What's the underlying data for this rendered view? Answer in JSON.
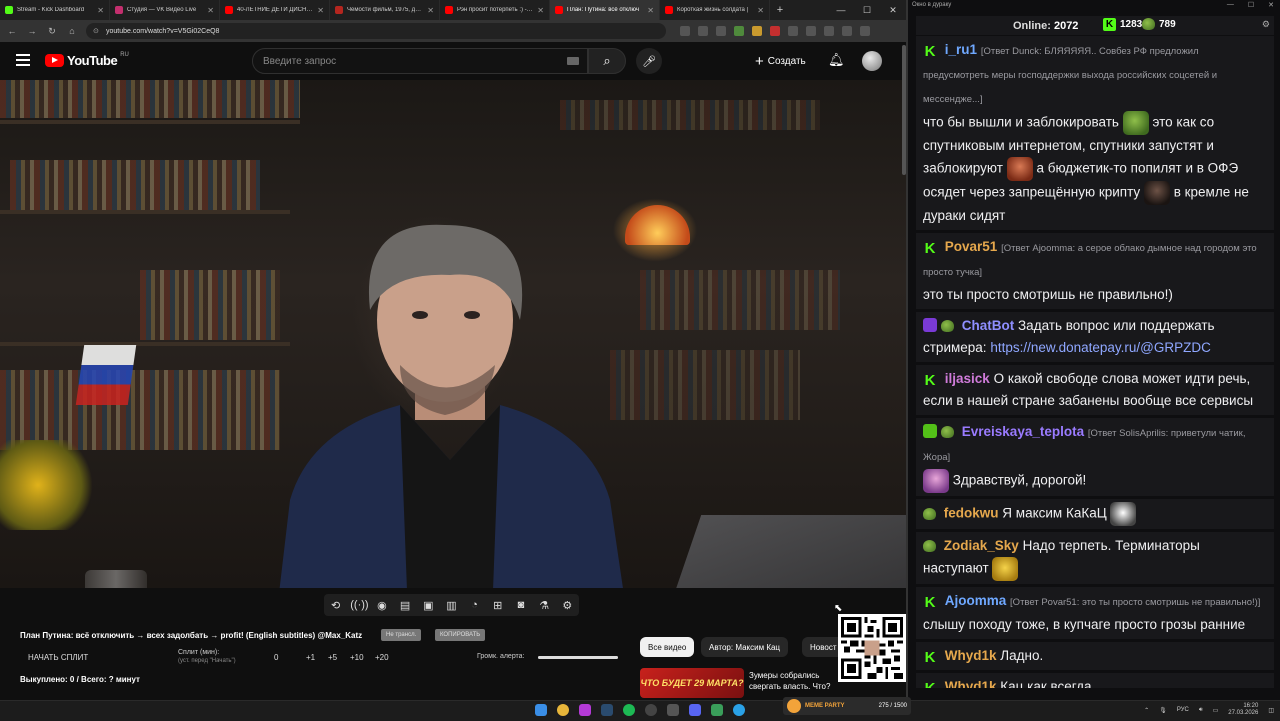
{
  "browser": {
    "tabs": [
      {
        "label": "Stream - Kick Dashboard",
        "color": "#53fc18",
        "active": false
      },
      {
        "label": "Студия — VK Видео Live",
        "color": "#c42f6e",
        "active": false
      },
      {
        "label": "40-ЛЕТНИЕ ДЕТИ ДИСНЕЯ",
        "color": "#ff0000",
        "active": false
      },
      {
        "label": "Чемости фильм, 1975, дата",
        "color": "#b5261f",
        "active": false
      },
      {
        "label": "Рэн просит потерпеть :) - Yo",
        "color": "#ff0000",
        "active": false
      },
      {
        "label": "План: Путина: всё отключ",
        "color": "#ff0000",
        "active": true
      },
      {
        "label": "Короткая жизнь солдата |",
        "color": "#ff0000",
        "active": false
      }
    ],
    "new_tab": "+",
    "url": "youtube.com/watch?v=V5Gi02CeQ8",
    "win_controls": [
      "—",
      "☐",
      "✕"
    ]
  },
  "youtube": {
    "logo": "YouTube",
    "region": "RU",
    "search_placeholder": "Введите запрос",
    "create_label": "Создать",
    "video_title": "План Путина: всё отключить → всех задолбать → profit! (English subtitles) @Max_Katz",
    "chip_not_stream": "Не трансл.",
    "chip_copy": "КОПИРОВАТЬ",
    "start_split": "НАЧАТЬ СПЛИТ",
    "split_label": "Сплит (мин):",
    "split_hint": "(уст. перед \"Начать\")",
    "split_values": [
      "0",
      "+1",
      "+5",
      "+10",
      "+20"
    ],
    "alert_volume_label": "Громк. алерта:",
    "alert_volume": 1.0,
    "bought": "Выкуплено: 0 / Всего: ? минут",
    "filter_chips": [
      "Все видео",
      "Автор: Максим Кац",
      "Новост"
    ],
    "related_title": "Зумеры собрались свергать власть. Что? Да",
    "related_thumb_text": "ЧТО БУДЕТ 29 МАРТА?"
  },
  "chat": {
    "window_title": "Окно в дураку",
    "online_label": "Online:",
    "online_count": "2072",
    "kick_count": "1283",
    "pepe_count": "789",
    "messages": [
      {
        "user": "i_ru1",
        "color": "#6fa8ff",
        "reply": "[Ответ Dunck: БЛЯЯЯЯЯ.. Совбез РФ предложил предусмотреть меры господдержки выхода российских соцсетей и мессендже...]",
        "text": "что бы вышли и заблокировать",
        "text2": "это как со спутниковым интернетом, спутники запустят и заблокируют",
        "text3": "а бюджетик-то попилят и в ОФЭ осядет через запрещённую крипту",
        "text4": "в кремле не дураки сидят"
      },
      {
        "user": "Povar51",
        "color": "#e6a84d",
        "reply": "[Ответ Ajoomma: а серое облако дымное над городом это просто тучка]",
        "text": "это ты просто смотришь не правильно!)"
      },
      {
        "user": "ChatBot",
        "color": "#8f8fff",
        "text": "Задать вопрос или поддержать стримера:",
        "link": "https://new.donatepay.ru/@GRPZDC"
      },
      {
        "user": "iljasick",
        "color": "#cf7bd9",
        "text": "О какой свободе слова может идти речь, если в нашей стране забанены вообще все сервисы"
      },
      {
        "user": "Evreiskaya_teplota",
        "color": "#9a7bff",
        "reply": "[Ответ SolisAprilis: приветули чатик, Жора]",
        "text": "Здравствуй, дорогой!"
      },
      {
        "user": "fedokwu",
        "color": "#e6a84d",
        "text": "Я максим КаКаЦ"
      },
      {
        "user": "Zodiak_Sky",
        "color": "#e6a84d",
        "text": "Надо терпеть. Терминаторы наступают"
      },
      {
        "user": "Ajoomma",
        "color": "#6fa8ff",
        "reply": "[Ответ Povar51: это ты просто смотришь не правильно!)]",
        "text": "слышу походу тоже, в купчаге просто грозы ранние"
      },
      {
        "user": "Whyd1k",
        "color": "#e6a84d",
        "text": "Ладно."
      },
      {
        "user": "Whyd1k",
        "color": "#e6a84d",
        "text": "Кац как всегда."
      }
    ]
  },
  "taskbar": {
    "meme_label": "MEME PARTY",
    "meme_count": "275 / 1500",
    "lang": "РУС",
    "time": "16:20",
    "date": "27.03.2026"
  }
}
